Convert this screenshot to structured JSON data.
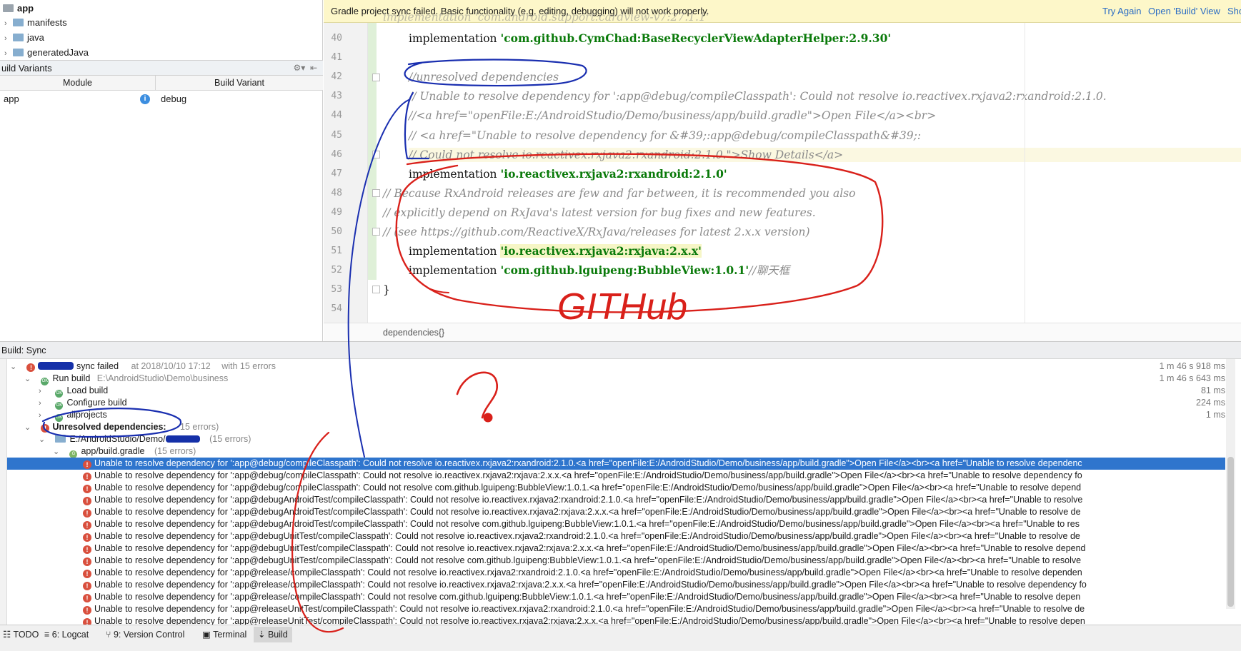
{
  "project_tree": {
    "root": "app",
    "items": [
      "manifests",
      "java",
      "generatedJava"
    ]
  },
  "build_variants": {
    "title": "uild Variants",
    "col_module": "Module",
    "col_variant": "Build Variant",
    "row_module": "app",
    "row_variant": "debug"
  },
  "banner": {
    "message": "Gradle project sync failed. Basic functionality (e.g. editing, debugging) will not work properly.",
    "try_again": "Try Again",
    "open_build": "Open 'Build' View",
    "show": "Sho"
  },
  "editor": {
    "lines": [
      {
        "n": "40",
        "pre": "implementation ",
        "str": "'com.github.CymChad:BaseRecyclerViewAdapterHelper:2.9.30'",
        "post": ""
      },
      {
        "n": "41",
        "cmt": ""
      },
      {
        "n": "42",
        "cmt": "//unresolved dependencies"
      },
      {
        "n": "43",
        "cmt": "// Unable to resolve dependency for ':app@debug/compileClasspath': Could not resolve io.reactivex.rxjava2:rxandroid:2.1.0."
      },
      {
        "n": "44",
        "cmt": "//<a href=\"openFile:E:/AndroidStudio/Demo/business/app/build.gradle\">Open File</a><br>"
      },
      {
        "n": "45",
        "cmt": "// <a href=\"Unable to resolve dependency for &#39;:app@debug/compileClasspath&#39;:"
      },
      {
        "n": "46",
        "cmt": "// Could not resolve io.reactivex.rxjava2:rxandroid:2.1.0.\">Show Details</a>"
      },
      {
        "n": "47",
        "pre": "implementation ",
        "str": "'io.reactivex.rxjava2:rxandroid:2.1.0'",
        "post": ""
      },
      {
        "n": "48",
        "cmt": "// Because RxAndroid releases are few and far between, it is recommended you also"
      },
      {
        "n": "49",
        "cmt": "// explicitly depend on RxJava's latest version for bug fixes and new features."
      },
      {
        "n": "50",
        "cmt": "// (see https://github.com/ReactiveX/RxJava/releases for latest 2.x.x version)"
      },
      {
        "n": "51",
        "pre": "implementation ",
        "str": "'io.reactivex.rxjava2:rxjava:2.x.x'",
        "post": ""
      },
      {
        "n": "52",
        "pre": "implementation ",
        "str": "'com.github.lguipeng:BubbleView:1.0.1'",
        "post": "//聊天框"
      },
      {
        "n": "53",
        "plain": "}"
      },
      {
        "n": "54",
        "plain": ""
      }
    ],
    "top_partial": "implementation 'com.android.support:cardview-v7:27.1.1'",
    "breadcrumb": "dependencies{}"
  },
  "build": {
    "header": "Build: Sync",
    "sync_failed": "sync failed",
    "sync_at": "at 2018/10/10 17:12",
    "sync_errors": "with 15 errors",
    "sync_time": "1 m 46 s 918 ms",
    "run_build": "Run build",
    "run_path": "E:\\AndroidStudio\\Demo\\business",
    "run_time": "1 m 46 s 643 ms",
    "load_build": "Load build",
    "load_time": "81 ms",
    "configure_build": "Configure build",
    "configure_time": "224 ms",
    "allprojects": "allprojects",
    "allprojects_time": "1 ms",
    "unresolved": "Unresolved dependencies:",
    "unresolved_count": "15 errors)",
    "path_node": "E:/AndroidStudio/Demo/",
    "path_count": "(15 errors)",
    "gradle_node": "app/build.gradle",
    "gradle_count": "(15 errors)",
    "errors": [
      "Unable to resolve dependency for ':app@debug/compileClasspath': Could not resolve io.reactivex.rxjava2:rxandroid:2.1.0.<a href=\"openFile:E:/AndroidStudio/Demo/business/app/build.gradle\">Open File</a><br><a href=\"Unable to resolve dependenc",
      "Unable to resolve dependency for ':app@debug/compileClasspath': Could not resolve io.reactivex.rxjava2:rxjava:2.x.x.<a href=\"openFile:E:/AndroidStudio/Demo/business/app/build.gradle\">Open File</a><br><a href=\"Unable to resolve dependency fo",
      "Unable to resolve dependency for ':app@debug/compileClasspath': Could not resolve com.github.lguipeng:BubbleView:1.0.1.<a href=\"openFile:E:/AndroidStudio/Demo/business/app/build.gradle\">Open File</a><br><a href=\"Unable to resolve depend",
      "Unable to resolve dependency for ':app@debugAndroidTest/compileClasspath': Could not resolve io.reactivex.rxjava2:rxandroid:2.1.0.<a href=\"openFile:E:/AndroidStudio/Demo/business/app/build.gradle\">Open File</a><br><a href=\"Unable to resolve",
      "Unable to resolve dependency for ':app@debugAndroidTest/compileClasspath': Could not resolve io.reactivex.rxjava2:rxjava:2.x.x.<a href=\"openFile:E:/AndroidStudio/Demo/business/app/build.gradle\">Open File</a><br><a href=\"Unable to resolve de",
      "Unable to resolve dependency for ':app@debugAndroidTest/compileClasspath': Could not resolve com.github.lguipeng:BubbleView:1.0.1.<a href=\"openFile:E:/AndroidStudio/Demo/business/app/build.gradle\">Open File</a><br><a href=\"Unable to res",
      "Unable to resolve dependency for ':app@debugUnitTest/compileClasspath': Could not resolve io.reactivex.rxjava2:rxandroid:2.1.0.<a href=\"openFile:E:/AndroidStudio/Demo/business/app/build.gradle\">Open File</a><br><a href=\"Unable to resolve de",
      "Unable to resolve dependency for ':app@debugUnitTest/compileClasspath': Could not resolve io.reactivex.rxjava2:rxjava:2.x.x.<a href=\"openFile:E:/AndroidStudio/Demo/business/app/build.gradle\">Open File</a><br><a href=\"Unable to resolve depend",
      "Unable to resolve dependency for ':app@debugUnitTest/compileClasspath': Could not resolve com.github.lguipeng:BubbleView:1.0.1.<a href=\"openFile:E:/AndroidStudio/Demo/business/app/build.gradle\">Open File</a><br><a href=\"Unable to resolve",
      "Unable to resolve dependency for ':app@release/compileClasspath': Could not resolve io.reactivex.rxjava2:rxandroid:2.1.0.<a href=\"openFile:E:/AndroidStudio/Demo/business/app/build.gradle\">Open File</a><br><a href=\"Unable to resolve dependen",
      "Unable to resolve dependency for ':app@release/compileClasspath': Could not resolve io.reactivex.rxjava2:rxjava:2.x.x.<a href=\"openFile:E:/AndroidStudio/Demo/business/app/build.gradle\">Open File</a><br><a href=\"Unable to resolve dependency fo",
      "Unable to resolve dependency for ':app@release/compileClasspath': Could not resolve com.github.lguipeng:BubbleView:1.0.1.<a href=\"openFile:E:/AndroidStudio/Demo/business/app/build.gradle\">Open File</a><br><a href=\"Unable to resolve depen",
      "Unable to resolve dependency for ':app@releaseUnitTest/compileClasspath': Could not resolve io.reactivex.rxjava2:rxandroid:2.1.0.<a href=\"openFile:E:/AndroidStudio/Demo/business/app/build.gradle\">Open File</a><br><a href=\"Unable to resolve de",
      "Unable to resolve dependency for ':app@releaseUnitTest/compileClasspath': Could not resolve io.reactivex.rxjava2:rxjava:2.x.x.<a href=\"openFile:E:/AndroidStudio/Demo/business/app/build.gradle\">Open File</a><br><a href=\"Unable to resolve depen"
    ]
  },
  "status_tabs": {
    "todo": "TODO",
    "logcat": "6: Logcat",
    "vcs": "9: Version Control",
    "terminal": "Terminal",
    "build": "Build"
  },
  "annotation": {
    "text": "GITHub",
    "question": "?"
  }
}
